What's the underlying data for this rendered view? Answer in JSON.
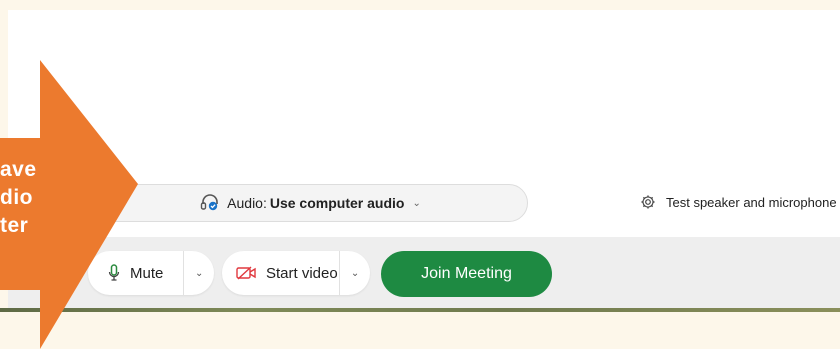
{
  "audio": {
    "label": "Audio:",
    "value": "Use computer audio",
    "headset_icon": "headset-icon",
    "chevron_icon": "chevron-down-icon"
  },
  "test_link": {
    "label": "Test speaker and microphone",
    "icon": "gear-icon"
  },
  "toolbar": {
    "mute_label": "Mute",
    "mute_icon": "microphone-icon",
    "video_label": "Start video",
    "video_icon": "video-off-icon",
    "join_label": "Join Meeting"
  },
  "annotation": {
    "line1": "ave",
    "line2": "dio",
    "line3": "ter",
    "color": "#ec7a2e"
  },
  "colors": {
    "join_green": "#1e8a42",
    "video_red": "#e0383e",
    "mic_green": "#2a8a3e",
    "check_blue": "#1a73c8",
    "background": "#fdf7ea"
  }
}
